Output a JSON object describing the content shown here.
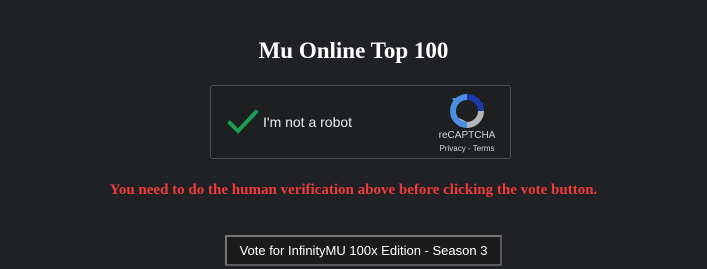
{
  "page": {
    "title": "Mu Online Top 100"
  },
  "captcha": {
    "label": "I'm not a robot",
    "checked": true,
    "brand": "reCAPTCHA",
    "privacy_label": "Privacy",
    "separator": " - ",
    "terms_label": "Terms",
    "check_icon": "checkmark-icon",
    "logo_icon": "recaptcha-logo-icon"
  },
  "warning": {
    "text": "You need to do the human verification above before clicking the vote button."
  },
  "vote": {
    "button_label": "Vote for InfinityMU 100x Edition - Season 3"
  },
  "colors": {
    "background": "#202124",
    "warning": "#ef3b3b",
    "checkmark": "#1a9e51",
    "recaptcha_blue": "#4a90e2",
    "recaptcha_dark_blue": "#1c3aa9",
    "recaptcha_gray": "#b4b4b4"
  }
}
